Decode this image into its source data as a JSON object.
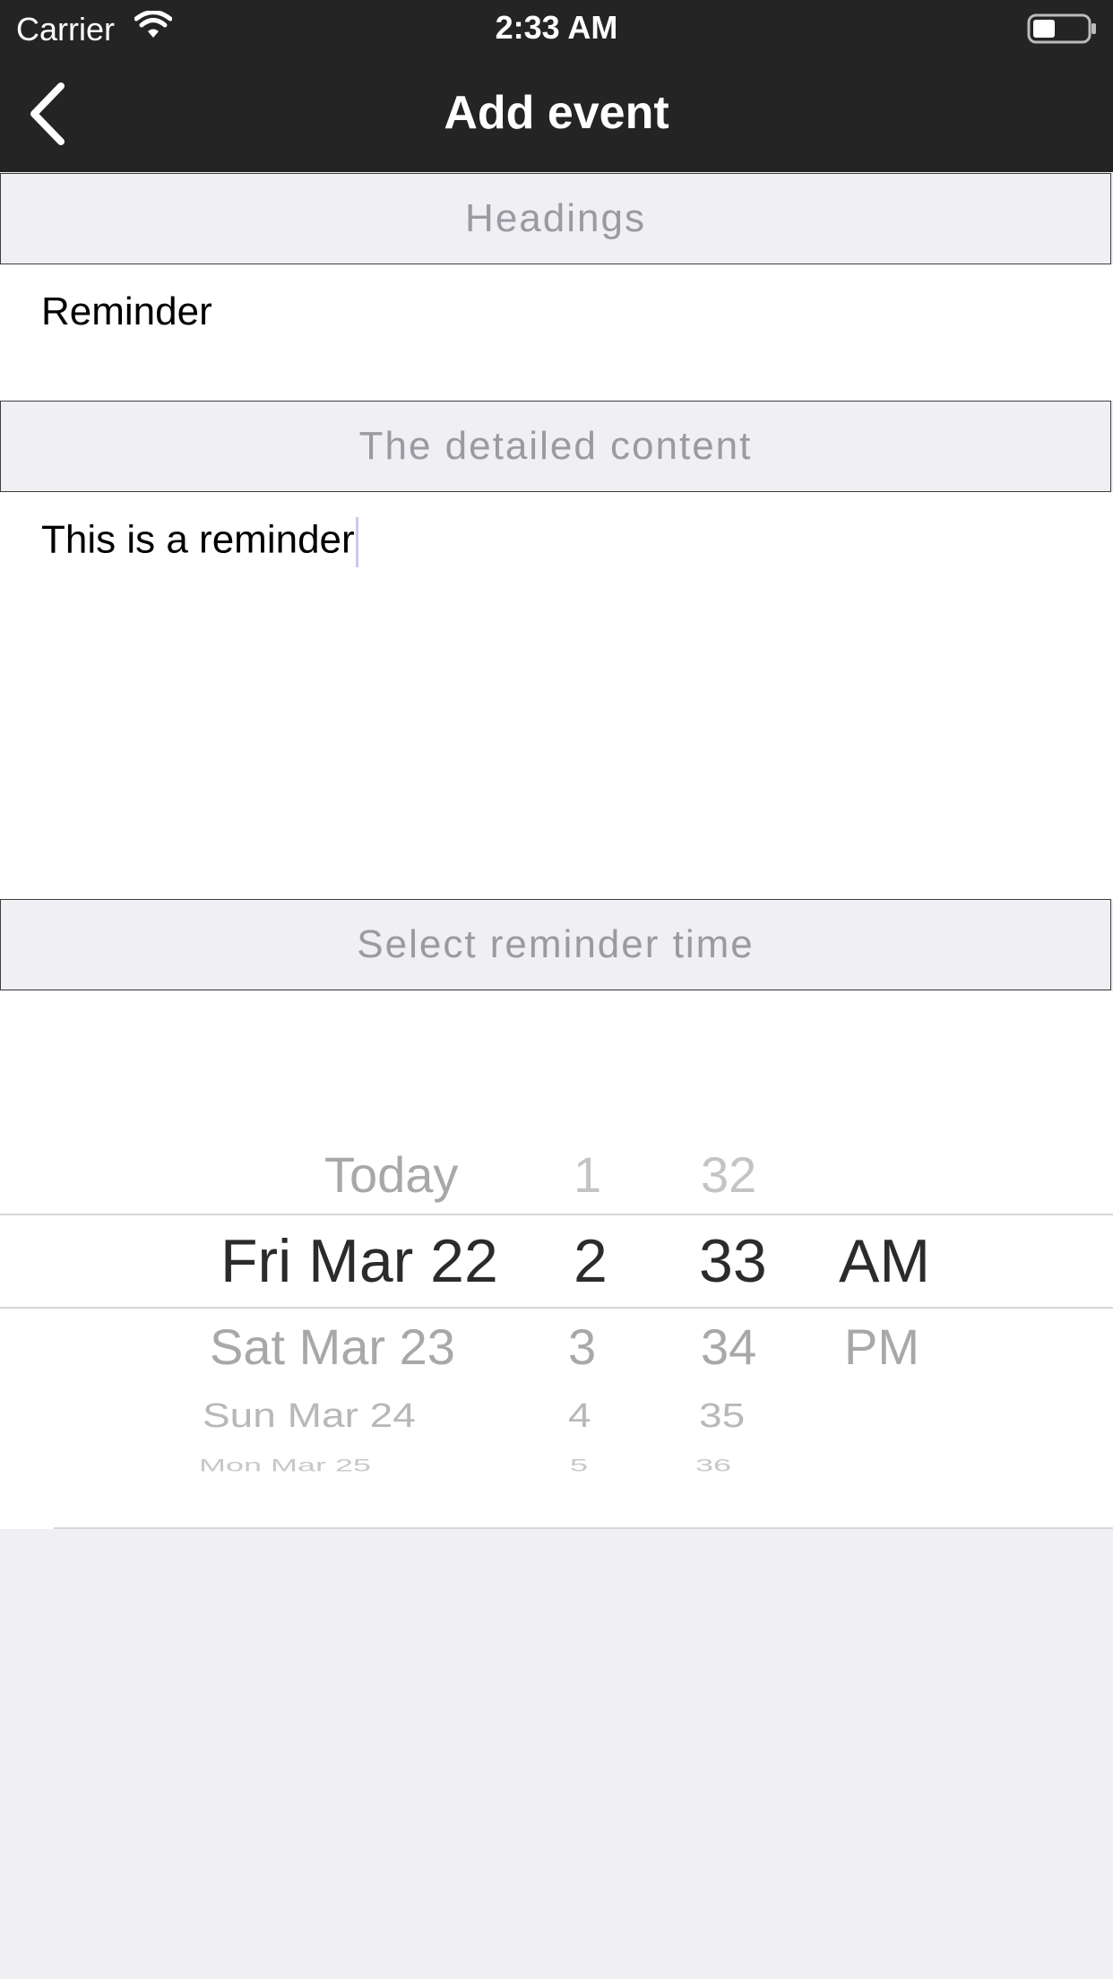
{
  "status_bar": {
    "carrier": "Carrier",
    "time": "2:33 AM"
  },
  "nav": {
    "title": "Add event"
  },
  "sections": {
    "headings_label": "Headings",
    "content_label": "The detailed content",
    "time_label": "Select reminder time"
  },
  "fields": {
    "heading_value": "Reminder",
    "content_value": "This is a reminder"
  },
  "picker": {
    "date_column": [
      "Today",
      "Fri Mar 22",
      "Sat Mar 23",
      "Sun Mar 24",
      "Mon Mar 25"
    ],
    "hour_column": [
      "1",
      "2",
      "3",
      "4",
      "5"
    ],
    "minute_column": [
      "32",
      "33",
      "34",
      "35",
      "36"
    ],
    "ampm_column": [
      "AM",
      "PM"
    ],
    "selected": {
      "date": "Fri Mar 22",
      "hour": "2",
      "minute": "33",
      "ampm": "AM"
    }
  },
  "colors": {
    "nav_background": "#242424",
    "page_background": "#efeff4",
    "section_text": "#9a9aa0"
  }
}
